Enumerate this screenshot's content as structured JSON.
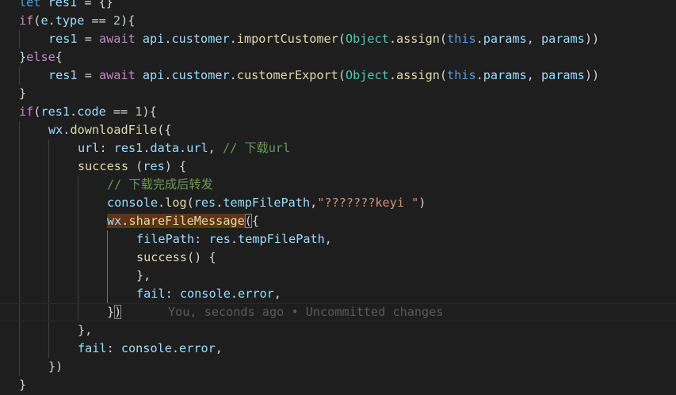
{
  "code": {
    "l1": {
      "a": "let",
      "b": " res1 ",
      "c": "=",
      "d": " {}"
    },
    "l2": {
      "a": "if",
      "b": "(",
      "c": "e",
      "d": ".",
      "e": "type",
      "f": " == ",
      "g": "2",
      "h": "){"
    },
    "l3": {
      "a": "res1",
      "b": " = ",
      "c": "await",
      "d": " ",
      "e": "api",
      "f": ".",
      "g": "customer",
      "h": ".",
      "i": "importCustomer",
      "j": "(",
      "k": "Object",
      "l": ".",
      "m": "assign",
      "n": "(",
      "o": "this",
      "p": ".",
      "q": "params",
      "r": ", ",
      "s": "params",
      "t": "))"
    },
    "l4": {
      "a": "}",
      "b": "else",
      "c": "{"
    },
    "l5": {
      "a": "res1",
      "b": " = ",
      "c": "await",
      "d": " ",
      "e": "api",
      "f": ".",
      "g": "customer",
      "h": ".",
      "i": "customerExport",
      "j": "(",
      "k": "Object",
      "l": ".",
      "m": "assign",
      "n": "(",
      "o": "this",
      "p": ".",
      "q": "params",
      "r": ", ",
      "s": "params",
      "t": "))"
    },
    "l6": {
      "a": "}"
    },
    "l7": {
      "a": "if",
      "b": "(",
      "c": "res1",
      "d": ".",
      "e": "code",
      "f": " == ",
      "g": "1",
      "h": "){"
    },
    "l8": {
      "a": "wx",
      "b": ".",
      "c": "downloadFile",
      "d": "({"
    },
    "l9": {
      "a": "url",
      "b": ": ",
      "c": "res1",
      "d": ".",
      "e": "data",
      "f": ".",
      "g": "url",
      "h": ", ",
      "i": "// 下载url"
    },
    "l10": {
      "a": "success",
      "b": " (",
      "c": "res",
      "d": ") {"
    },
    "l11": {
      "a": "// 下载完成后转发"
    },
    "l12": {
      "a": "console",
      "b": ".",
      "c": "log",
      "d": "(",
      "e": "res",
      "f": ".",
      "g": "tempFilePath",
      "h": ",",
      "i": "\"???????keyi \"",
      "j": ")"
    },
    "l13": {
      "a": "wx",
      "b": ".",
      "c": "shareFileMessage",
      "d": "(",
      "e": "{"
    },
    "l14": {
      "a": "filePath",
      "b": ": ",
      "c": "res",
      "d": ".",
      "e": "tempFilePath",
      "f": ","
    },
    "l15": {
      "a": "success",
      "b": "() {"
    },
    "l16": {
      "a": "},"
    },
    "l17": {
      "a": "fail",
      "b": ": ",
      "c": "console",
      "d": ".",
      "e": "error",
      "f": ","
    },
    "l18": {
      "a": "}",
      "b": ")"
    },
    "l19": {
      "a": "},"
    },
    "l20": {
      "a": "fail",
      "b": ": ",
      "c": "console",
      "d": ".",
      "e": "error",
      "f": ","
    },
    "l21": {
      "a": "})"
    },
    "l22": {
      "a": "}"
    }
  },
  "blame_text": "You, seconds ago • Uncommitted changes",
  "colors": {
    "background": "#1e1e1e",
    "keyword": "#569cd6",
    "control": "#c586c0",
    "function": "#dcdcaa",
    "variable": "#9cdcfe",
    "class": "#4ec9b0",
    "number": "#b5cea8",
    "string": "#ce9178",
    "comment": "#6a9955",
    "highlight": "#613214"
  }
}
